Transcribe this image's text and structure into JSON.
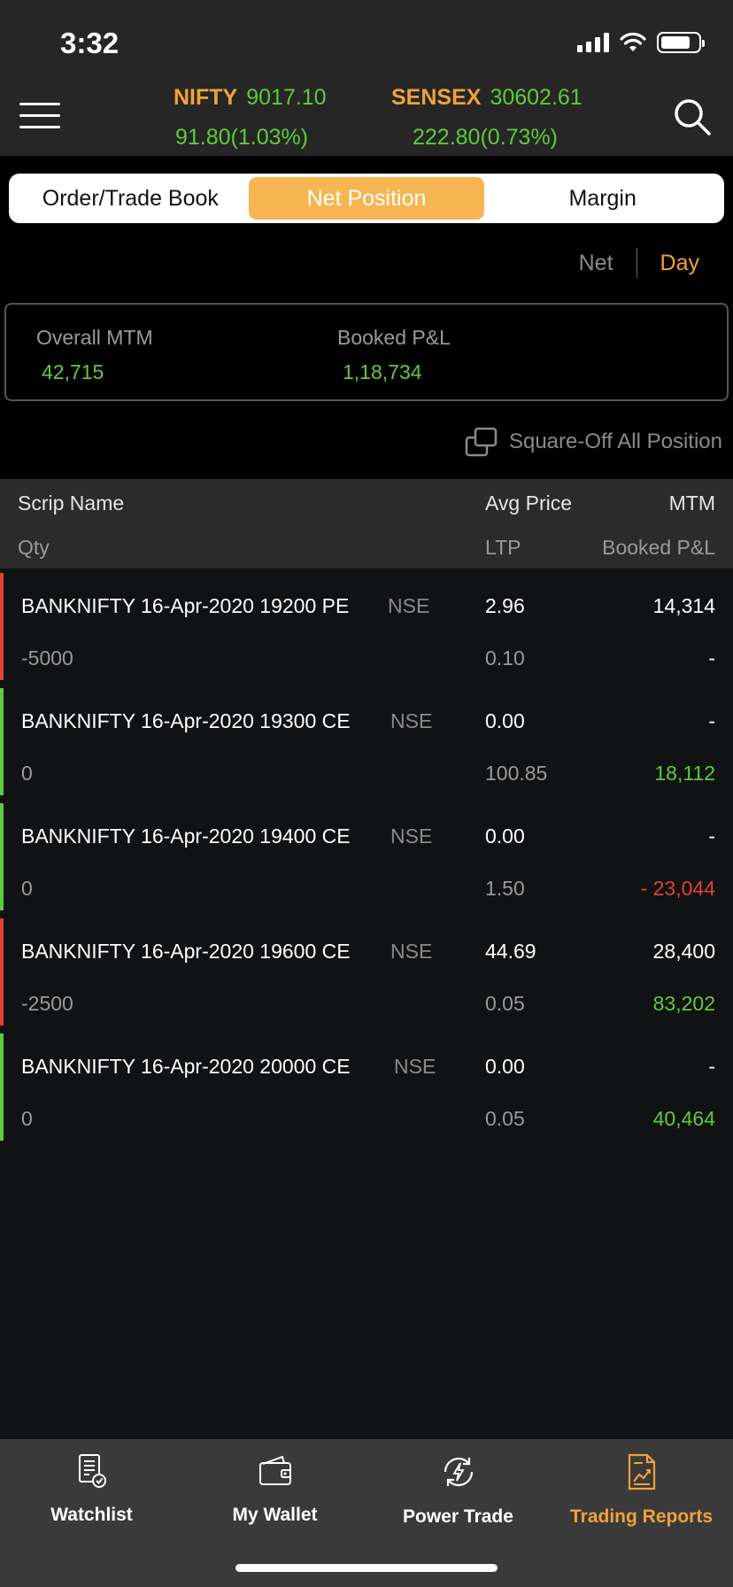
{
  "status_bar": {
    "time": "3:32"
  },
  "header": {
    "indices": [
      {
        "name": "NIFTY",
        "value": "9017.10",
        "change": "91.80(1.03%)"
      },
      {
        "name": "SENSEX",
        "value": "30602.61",
        "change": "222.80(0.73%)"
      }
    ]
  },
  "tabs": [
    {
      "label": "Order/Trade Book",
      "active": false
    },
    {
      "label": "Net Position",
      "active": true
    },
    {
      "label": "Margin",
      "active": false
    }
  ],
  "toggle": {
    "net": "Net",
    "day": "Day",
    "selected": "Day"
  },
  "summary": {
    "overall_mtm_label": "Overall MTM",
    "overall_mtm": "42,715",
    "booked_label": "Booked P&L",
    "booked": "1,18,734"
  },
  "square_off_label": "Square-Off All Position",
  "table": {
    "headers": {
      "scrip": "Scrip Name",
      "avg": "Avg Price",
      "mtm": "MTM",
      "qty": "Qty",
      "ltp": "LTP",
      "booked": "Booked P&L"
    },
    "rows": [
      {
        "scrip": "BANKNIFTY 16-Apr-2020 19200 PE",
        "exchange": "NSE",
        "avg": "2.96",
        "mtm": "14,314",
        "qty": "-5000",
        "ltp": "0.10",
        "booked": "-",
        "side_color": "#e0432f",
        "booked_color": "#ffffff"
      },
      {
        "scrip": "BANKNIFTY 16-Apr-2020 19300 CE",
        "exchange": "NSE",
        "avg": "0.00",
        "mtm": "-",
        "qty": "0",
        "ltp": "100.85",
        "booked": "18,112",
        "side_color": "#5ecb3a",
        "booked_color": "#5ecb3a"
      },
      {
        "scrip": "BANKNIFTY 16-Apr-2020 19400 CE",
        "exchange": "NSE",
        "avg": "0.00",
        "mtm": "-",
        "qty": "0",
        "ltp": "1.50",
        "booked": "- 23,044",
        "side_color": "#5ecb3a",
        "booked_color": "#e0432f"
      },
      {
        "scrip": "BANKNIFTY 16-Apr-2020 19600 CE",
        "exchange": "NSE",
        "avg": "44.69",
        "mtm": "28,400",
        "qty": "-2500",
        "ltp": "0.05",
        "booked": "83,202",
        "side_color": "#e0432f",
        "booked_color": "#5ecb3a"
      },
      {
        "scrip": "BANKNIFTY 16-Apr-2020 20000 CE",
        "exchange": "NSE",
        "avg": "0.00",
        "mtm": "-",
        "qty": "0",
        "ltp": "0.05",
        "booked": "40,464",
        "side_color": "#5ecb3a",
        "booked_color": "#5ecb3a"
      }
    ]
  },
  "bottom_nav": [
    {
      "label": "Watchlist",
      "icon": "watchlist-icon",
      "active": false
    },
    {
      "label": "My Wallet",
      "icon": "wallet-icon",
      "active": false
    },
    {
      "label": "Power Trade",
      "icon": "power-trade-icon",
      "active": false
    },
    {
      "label": "Trading Reports",
      "icon": "trading-reports-icon",
      "active": true
    }
  ],
  "colors": {
    "accent": "#f0a23a",
    "positive": "#5ecb3a",
    "negative": "#e0432f"
  }
}
